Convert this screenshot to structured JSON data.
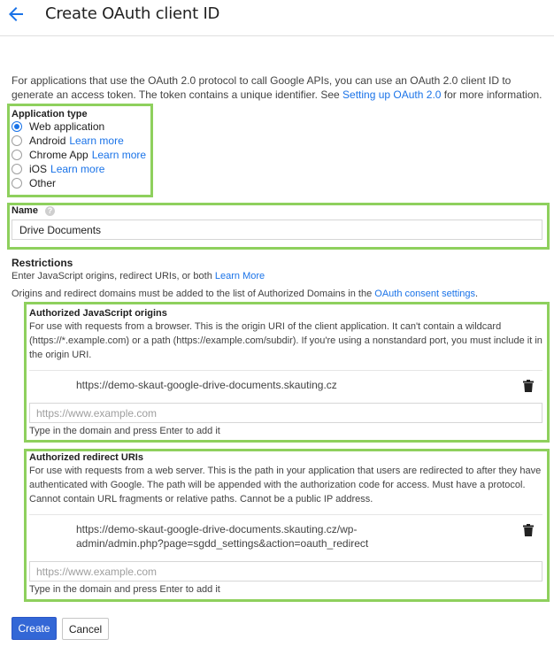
{
  "header": {
    "title": "Create OAuth client ID",
    "back_icon": "arrow-back-icon"
  },
  "intro": {
    "text_before": "For applications that use the OAuth 2.0 protocol to call Google APIs, you can use an OAuth 2.0 client ID to generate an access token. The token contains a unique identifier. See ",
    "link": "Setting up OAuth 2.0",
    "text_after": " for more information."
  },
  "application_type": {
    "label": "Application type",
    "options": [
      {
        "label": "Web application",
        "link": "",
        "selected": true
      },
      {
        "label": "Android",
        "link": "Learn more",
        "selected": false
      },
      {
        "label": "Chrome App",
        "link": "Learn more",
        "selected": false
      },
      {
        "label": "iOS",
        "link": "Learn more",
        "selected": false
      },
      {
        "label": "Other",
        "link": "",
        "selected": false
      }
    ]
  },
  "name": {
    "label": "Name",
    "help_icon": "?",
    "value": "Drive Documents"
  },
  "restrictions": {
    "title": "Restrictions",
    "desc": "Enter JavaScript origins, redirect URIs, or both",
    "desc_link": "Learn More",
    "note": "Origins and redirect domains must be added to the list of Authorized Domains in the ",
    "note_link": "OAuth consent settings",
    "note_end": "."
  },
  "js_origins": {
    "title": "Authorized JavaScript origins",
    "desc": "For use with requests from a browser. This is the origin URI of the client application. It can't contain a wildcard (https://*.example.com) or a path (https://example.com/subdir). If you're using a nonstandard port, you must include it in the origin URI.",
    "uri": "https://demo-skaut-google-drive-documents.skauting.cz",
    "placeholder": "https://www.example.com",
    "hint": "Type in the domain and press Enter to add it"
  },
  "redirect_uris": {
    "title": "Authorized redirect URIs",
    "desc": "For use with requests from a web server. This is the path in your application that users are redirected to after they have authenticated with Google. The path will be appended with the authorization code for access. Must have a protocol. Cannot contain URL fragments or relative paths. Cannot be a public IP address.",
    "uri": "https://demo-skaut-google-drive-documents.skauting.cz/wp-admin/admin.php?page=sgdd_settings&action=oauth_redirect",
    "placeholder": "https://www.example.com",
    "hint": "Type in the domain and press Enter to add it"
  },
  "actions": {
    "create": "Create",
    "cancel": "Cancel"
  },
  "colors": {
    "accent": "#1a73e8",
    "highlight": "#8ed05d",
    "primary_button": "#3367d6"
  }
}
